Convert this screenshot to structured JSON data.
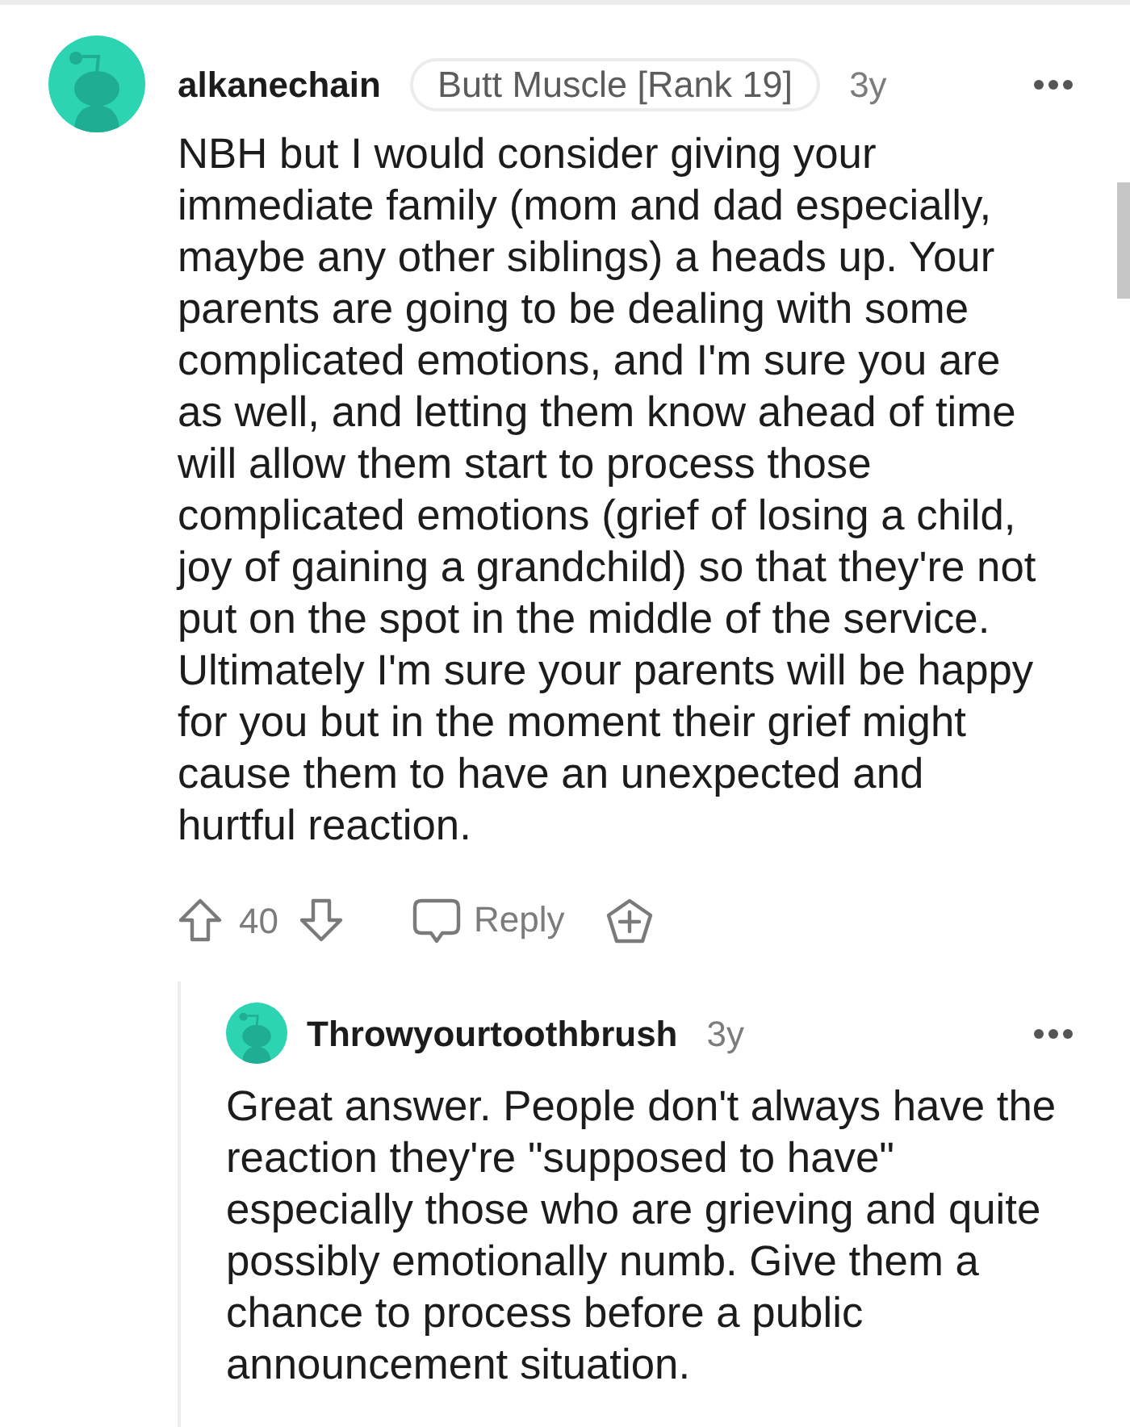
{
  "comments": [
    {
      "author": "alkanechain",
      "flair": "Butt Muscle [Rank 19]",
      "age": "3y",
      "body": "NBH but I would consider giving your immediate family (mom and dad especially, maybe any other siblings) a heads up. Your parents are going to be dealing with some complicated emotions, and I'm sure you are as well, and letting them know ahead of time will allow them start to process those complicated emotions (grief of losing a child, joy of gaining a grandchild) so that they're not put on the spot in the middle of the service. Ultimately I'm sure your parents will be happy for you but in the moment their grief might cause them to have an unexpected and hurtful reaction.",
      "votes": "40",
      "reply_label": "Reply",
      "children": [
        {
          "author": "Throwyourtoothbrush",
          "age": "3y",
          "body": "Great answer. People don't always have the reaction they're \"supposed to have\" especially those who are grieving and quite possibly emotionally numb. Give them a chance to process before a public announcement situation."
        }
      ]
    }
  ]
}
